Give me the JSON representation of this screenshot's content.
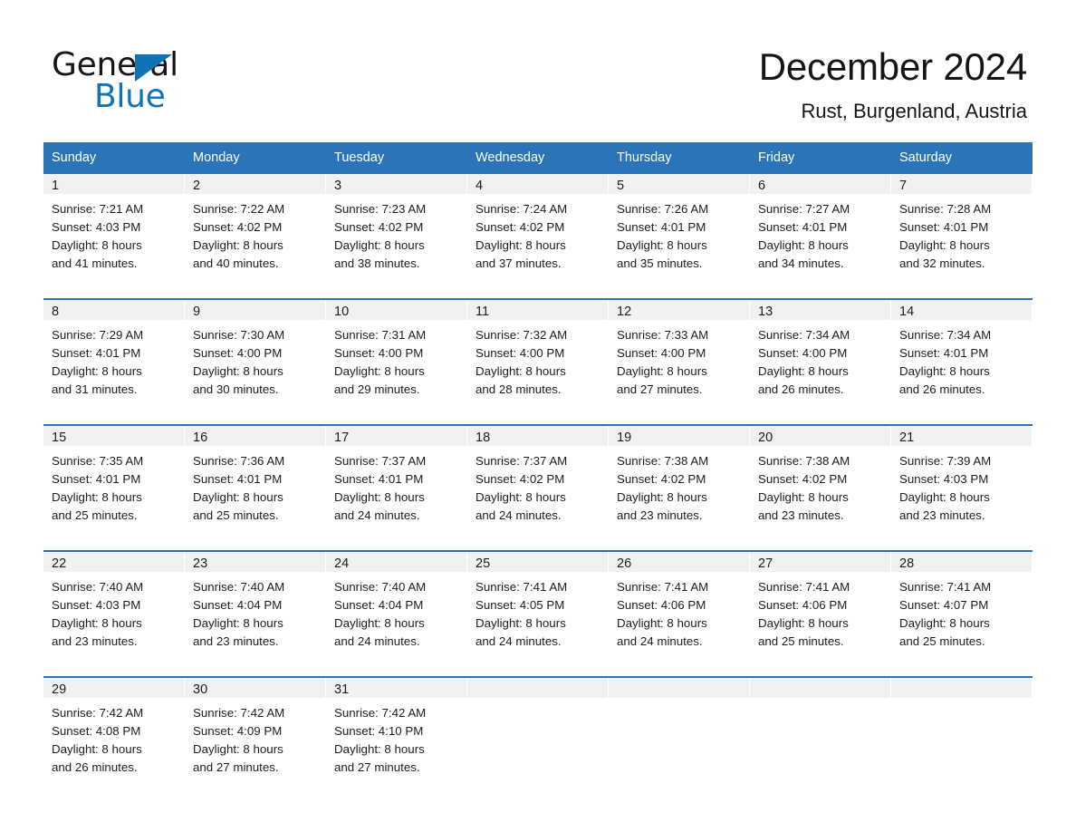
{
  "brand": {
    "name_part1": "General",
    "name_part2": "Blue",
    "accent_color": "#1272b6"
  },
  "header": {
    "month_title": "December 2024",
    "location": "Rust, Burgenland, Austria"
  },
  "theme": {
    "header_blue": "#2b74b8",
    "daynum_band": "#f1f1f1",
    "text": "#1d1d1d"
  },
  "calendar": {
    "weekday_headers": [
      "Sunday",
      "Monday",
      "Tuesday",
      "Wednesday",
      "Thursday",
      "Friday",
      "Saturday"
    ],
    "weeks": [
      [
        {
          "day": "1",
          "sunrise": "Sunrise: 7:21 AM",
          "sunset": "Sunset: 4:03 PM",
          "daylight_line1": "Daylight: 8 hours",
          "daylight_line2": "and 41 minutes."
        },
        {
          "day": "2",
          "sunrise": "Sunrise: 7:22 AM",
          "sunset": "Sunset: 4:02 PM",
          "daylight_line1": "Daylight: 8 hours",
          "daylight_line2": "and 40 minutes."
        },
        {
          "day": "3",
          "sunrise": "Sunrise: 7:23 AM",
          "sunset": "Sunset: 4:02 PM",
          "daylight_line1": "Daylight: 8 hours",
          "daylight_line2": "and 38 minutes."
        },
        {
          "day": "4",
          "sunrise": "Sunrise: 7:24 AM",
          "sunset": "Sunset: 4:02 PM",
          "daylight_line1": "Daylight: 8 hours",
          "daylight_line2": "and 37 minutes."
        },
        {
          "day": "5",
          "sunrise": "Sunrise: 7:26 AM",
          "sunset": "Sunset: 4:01 PM",
          "daylight_line1": "Daylight: 8 hours",
          "daylight_line2": "and 35 minutes."
        },
        {
          "day": "6",
          "sunrise": "Sunrise: 7:27 AM",
          "sunset": "Sunset: 4:01 PM",
          "daylight_line1": "Daylight: 8 hours",
          "daylight_line2": "and 34 minutes."
        },
        {
          "day": "7",
          "sunrise": "Sunrise: 7:28 AM",
          "sunset": "Sunset: 4:01 PM",
          "daylight_line1": "Daylight: 8 hours",
          "daylight_line2": "and 32 minutes."
        }
      ],
      [
        {
          "day": "8",
          "sunrise": "Sunrise: 7:29 AM",
          "sunset": "Sunset: 4:01 PM",
          "daylight_line1": "Daylight: 8 hours",
          "daylight_line2": "and 31 minutes."
        },
        {
          "day": "9",
          "sunrise": "Sunrise: 7:30 AM",
          "sunset": "Sunset: 4:00 PM",
          "daylight_line1": "Daylight: 8 hours",
          "daylight_line2": "and 30 minutes."
        },
        {
          "day": "10",
          "sunrise": "Sunrise: 7:31 AM",
          "sunset": "Sunset: 4:00 PM",
          "daylight_line1": "Daylight: 8 hours",
          "daylight_line2": "and 29 minutes."
        },
        {
          "day": "11",
          "sunrise": "Sunrise: 7:32 AM",
          "sunset": "Sunset: 4:00 PM",
          "daylight_line1": "Daylight: 8 hours",
          "daylight_line2": "and 28 minutes."
        },
        {
          "day": "12",
          "sunrise": "Sunrise: 7:33 AM",
          "sunset": "Sunset: 4:00 PM",
          "daylight_line1": "Daylight: 8 hours",
          "daylight_line2": "and 27 minutes."
        },
        {
          "day": "13",
          "sunrise": "Sunrise: 7:34 AM",
          "sunset": "Sunset: 4:00 PM",
          "daylight_line1": "Daylight: 8 hours",
          "daylight_line2": "and 26 minutes."
        },
        {
          "day": "14",
          "sunrise": "Sunrise: 7:34 AM",
          "sunset": "Sunset: 4:01 PM",
          "daylight_line1": "Daylight: 8 hours",
          "daylight_line2": "and 26 minutes."
        }
      ],
      [
        {
          "day": "15",
          "sunrise": "Sunrise: 7:35 AM",
          "sunset": "Sunset: 4:01 PM",
          "daylight_line1": "Daylight: 8 hours",
          "daylight_line2": "and 25 minutes."
        },
        {
          "day": "16",
          "sunrise": "Sunrise: 7:36 AM",
          "sunset": "Sunset: 4:01 PM",
          "daylight_line1": "Daylight: 8 hours",
          "daylight_line2": "and 25 minutes."
        },
        {
          "day": "17",
          "sunrise": "Sunrise: 7:37 AM",
          "sunset": "Sunset: 4:01 PM",
          "daylight_line1": "Daylight: 8 hours",
          "daylight_line2": "and 24 minutes."
        },
        {
          "day": "18",
          "sunrise": "Sunrise: 7:37 AM",
          "sunset": "Sunset: 4:02 PM",
          "daylight_line1": "Daylight: 8 hours",
          "daylight_line2": "and 24 minutes."
        },
        {
          "day": "19",
          "sunrise": "Sunrise: 7:38 AM",
          "sunset": "Sunset: 4:02 PM",
          "daylight_line1": "Daylight: 8 hours",
          "daylight_line2": "and 23 minutes."
        },
        {
          "day": "20",
          "sunrise": "Sunrise: 7:38 AM",
          "sunset": "Sunset: 4:02 PM",
          "daylight_line1": "Daylight: 8 hours",
          "daylight_line2": "and 23 minutes."
        },
        {
          "day": "21",
          "sunrise": "Sunrise: 7:39 AM",
          "sunset": "Sunset: 4:03 PM",
          "daylight_line1": "Daylight: 8 hours",
          "daylight_line2": "and 23 minutes."
        }
      ],
      [
        {
          "day": "22",
          "sunrise": "Sunrise: 7:40 AM",
          "sunset": "Sunset: 4:03 PM",
          "daylight_line1": "Daylight: 8 hours",
          "daylight_line2": "and 23 minutes."
        },
        {
          "day": "23",
          "sunrise": "Sunrise: 7:40 AM",
          "sunset": "Sunset: 4:04 PM",
          "daylight_line1": "Daylight: 8 hours",
          "daylight_line2": "and 23 minutes."
        },
        {
          "day": "24",
          "sunrise": "Sunrise: 7:40 AM",
          "sunset": "Sunset: 4:04 PM",
          "daylight_line1": "Daylight: 8 hours",
          "daylight_line2": "and 24 minutes."
        },
        {
          "day": "25",
          "sunrise": "Sunrise: 7:41 AM",
          "sunset": "Sunset: 4:05 PM",
          "daylight_line1": "Daylight: 8 hours",
          "daylight_line2": "and 24 minutes."
        },
        {
          "day": "26",
          "sunrise": "Sunrise: 7:41 AM",
          "sunset": "Sunset: 4:06 PM",
          "daylight_line1": "Daylight: 8 hours",
          "daylight_line2": "and 24 minutes."
        },
        {
          "day": "27",
          "sunrise": "Sunrise: 7:41 AM",
          "sunset": "Sunset: 4:06 PM",
          "daylight_line1": "Daylight: 8 hours",
          "daylight_line2": "and 25 minutes."
        },
        {
          "day": "28",
          "sunrise": "Sunrise: 7:41 AM",
          "sunset": "Sunset: 4:07 PM",
          "daylight_line1": "Daylight: 8 hours",
          "daylight_line2": "and 25 minutes."
        }
      ],
      [
        {
          "day": "29",
          "sunrise": "Sunrise: 7:42 AM",
          "sunset": "Sunset: 4:08 PM",
          "daylight_line1": "Daylight: 8 hours",
          "daylight_line2": "and 26 minutes."
        },
        {
          "day": "30",
          "sunrise": "Sunrise: 7:42 AM",
          "sunset": "Sunset: 4:09 PM",
          "daylight_line1": "Daylight: 8 hours",
          "daylight_line2": "and 27 minutes."
        },
        {
          "day": "31",
          "sunrise": "Sunrise: 7:42 AM",
          "sunset": "Sunset: 4:10 PM",
          "daylight_line1": "Daylight: 8 hours",
          "daylight_line2": "and 27 minutes."
        },
        {
          "day": "",
          "sunrise": "",
          "sunset": "",
          "daylight_line1": "",
          "daylight_line2": ""
        },
        {
          "day": "",
          "sunrise": "",
          "sunset": "",
          "daylight_line1": "",
          "daylight_line2": ""
        },
        {
          "day": "",
          "sunrise": "",
          "sunset": "",
          "daylight_line1": "",
          "daylight_line2": ""
        },
        {
          "day": "",
          "sunrise": "",
          "sunset": "",
          "daylight_line1": "",
          "daylight_line2": ""
        }
      ]
    ]
  }
}
